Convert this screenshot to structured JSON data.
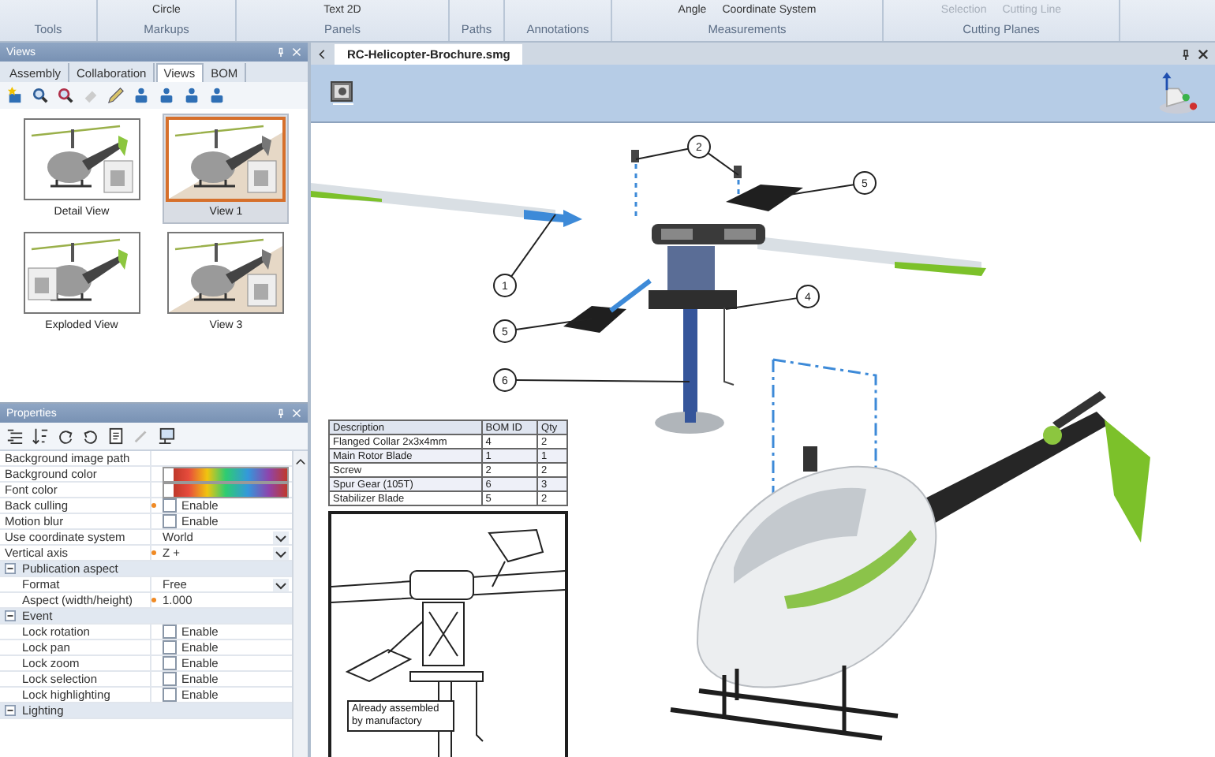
{
  "ribbon": {
    "groups": [
      {
        "label": "Tools"
      },
      {
        "label": "Markups",
        "items": [
          {
            "label": "Circle",
            "disabled": false
          }
        ]
      },
      {
        "label": "Panels",
        "items": [
          {
            "label": "Text 2D",
            "disabled": false
          }
        ]
      },
      {
        "label": "Paths"
      },
      {
        "label": "Annotations"
      },
      {
        "label": "Measurements",
        "items": [
          {
            "label": "Angle",
            "disabled": false
          },
          {
            "label": "Coordinate System",
            "disabled": false
          }
        ]
      },
      {
        "label": "Cutting Planes",
        "items": [
          {
            "label": "Selection",
            "disabled": true
          },
          {
            "label": "Cutting Line",
            "disabled": true
          }
        ]
      }
    ]
  },
  "views_panel": {
    "title": "Views",
    "tabs": [
      {
        "label": "Assembly",
        "selected": false
      },
      {
        "label": "Collaboration",
        "selected": false
      },
      {
        "label": "Views",
        "selected": true
      },
      {
        "label": "BOM",
        "selected": false
      }
    ],
    "thumbnails": [
      {
        "label": "Detail View",
        "selected": false
      },
      {
        "label": "View 1",
        "selected": true
      },
      {
        "label": "Exploded View",
        "selected": false
      },
      {
        "label": "View 3",
        "selected": false
      }
    ]
  },
  "properties_panel": {
    "title": "Properties",
    "rows": [
      {
        "kind": "text",
        "label": "Background image path",
        "modified": false
      },
      {
        "kind": "color",
        "label": "Background color",
        "modified": false
      },
      {
        "kind": "color",
        "label": "Font color",
        "modified": false
      },
      {
        "kind": "checkbox",
        "label": "Back culling",
        "value": "Enable",
        "checked": false,
        "modified": true
      },
      {
        "kind": "checkbox",
        "label": "Motion blur",
        "value": "Enable",
        "checked": false,
        "modified": false
      },
      {
        "kind": "dropdown",
        "label": "Use coordinate system",
        "value": "World",
        "modified": false
      },
      {
        "kind": "dropdown",
        "label": "Vertical axis",
        "value": "Z +",
        "modified": true
      },
      {
        "kind": "category",
        "label": "Publication aspect",
        "expanded": true,
        "children": [
          {
            "kind": "dropdown",
            "label": "Format",
            "value": "Free",
            "modified": false
          },
          {
            "kind": "text",
            "label": "Aspect (width/height)",
            "value": "1.000",
            "modified": true
          }
        ]
      },
      {
        "kind": "category",
        "label": "Event",
        "expanded": true,
        "children": [
          {
            "kind": "checkbox",
            "label": "Lock rotation",
            "value": "Enable",
            "checked": false,
            "modified": false
          },
          {
            "kind": "checkbox",
            "label": "Lock pan",
            "value": "Enable",
            "checked": false,
            "modified": false
          },
          {
            "kind": "checkbox",
            "label": "Lock zoom",
            "value": "Enable",
            "checked": false,
            "modified": false
          },
          {
            "kind": "checkbox",
            "label": "Lock selection",
            "value": "Enable",
            "checked": false,
            "modified": false
          },
          {
            "kind": "checkbox",
            "label": "Lock highlighting",
            "value": "Enable",
            "checked": false,
            "modified": false
          }
        ]
      },
      {
        "kind": "category",
        "label": "Lighting",
        "expanded": true
      }
    ]
  },
  "document": {
    "tabs": [
      {
        "label": "RC-Helicopter-Brochure.smg",
        "selected": true
      }
    ],
    "callouts": [
      "2",
      "5",
      "1",
      "5",
      "4",
      "6"
    ],
    "bom_table": {
      "columns": [
        "Description",
        "BOM ID",
        "Qty"
      ],
      "rows": [
        [
          "Flanged Collar 2x3x4mm",
          "4",
          "2"
        ],
        [
          "Main Rotor Blade",
          "1",
          "1"
        ],
        [
          "Screw",
          "2",
          "2"
        ],
        [
          "Spur Gear (105T)",
          "6",
          "3"
        ],
        [
          "Stabilizer Blade",
          "5",
          "2"
        ]
      ]
    },
    "inset_note": "Already assembled by manufactory"
  }
}
